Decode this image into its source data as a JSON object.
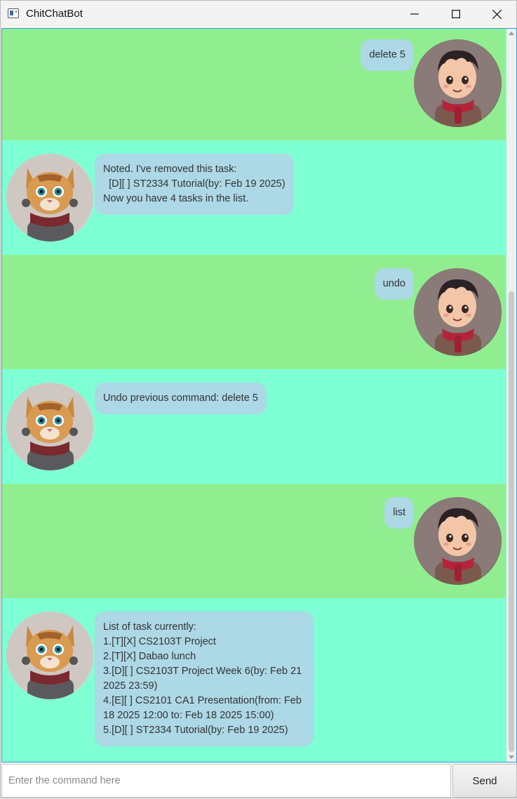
{
  "window": {
    "title": "ChitChatBot",
    "minimize_icon": "minimize-icon",
    "maximize_icon": "maximize-icon",
    "close_icon": "close-icon"
  },
  "colors": {
    "user_row": "#90ee90",
    "bot_row": "#7fffd4",
    "bubble": "#add8e6"
  },
  "messages": [
    {
      "sender": "user",
      "text": "delete 5"
    },
    {
      "sender": "bot",
      "text": "Noted. I've removed this task:\n  [D][ ] ST2334 Tutorial(by: Feb 19 2025)\nNow you have 4 tasks in the list."
    },
    {
      "sender": "user",
      "text": "undo"
    },
    {
      "sender": "bot",
      "text": "Undo previous command: delete 5"
    },
    {
      "sender": "user",
      "text": "list"
    },
    {
      "sender": "bot",
      "text": "List of task currently:\n1.[T][X] CS2103T Project\n2.[T][X] Dabao lunch\n3.[D][ ] CS2103T Project Week 6(by: Feb 21\n2025 23:59)\n4.[E][ ] CS2101 CA1 Presentation(from: Feb\n18 2025 12:00 to: Feb 18 2025 15:00)\n5.[D][ ] ST2334 Tutorial(by: Feb 19 2025)"
    }
  ],
  "avatars": {
    "user": "boy-avatar",
    "bot": "cat-robot-avatar"
  },
  "input": {
    "placeholder": "Enter the command here",
    "value": ""
  },
  "send_button": {
    "label": "Send"
  }
}
